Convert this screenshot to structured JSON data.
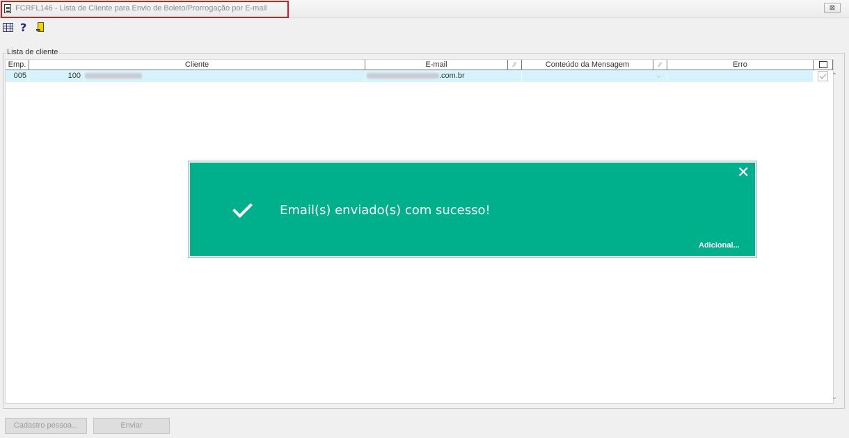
{
  "window": {
    "title": "FCRFL146 - Lista de Cliente para Envio de Boleto/Prorrogação por E-mail",
    "close_label": "⊠"
  },
  "toolbar": {
    "icons": [
      "grid-icon",
      "help-icon",
      "exit-icon"
    ],
    "help_glyph": "?"
  },
  "group": {
    "title": "Lista de cliente"
  },
  "table": {
    "columns": [
      "Emp.",
      "Cliente",
      "E-mail",
      "Conteúdo da Mensagem",
      "Erro"
    ],
    "sort_glyph": "⁄⁄",
    "rows": [
      {
        "emp": "005",
        "cliente_codigo": "100",
        "cliente_nome": "",
        "email_suffix": ".com.br",
        "conteudo": "",
        "erro": ""
      }
    ]
  },
  "notification": {
    "message": "Email(s) enviado(s) com sucesso!",
    "more_label": "Adicional...",
    "close_glyph": "✕",
    "color": "#00b08c"
  },
  "buttons": {
    "cadastro": "Cadastro pessoa...",
    "enviar": "Enviar"
  },
  "colors": {
    "row_highlight": "#d6f3fd",
    "title_highlight_border": "#e0161f"
  }
}
